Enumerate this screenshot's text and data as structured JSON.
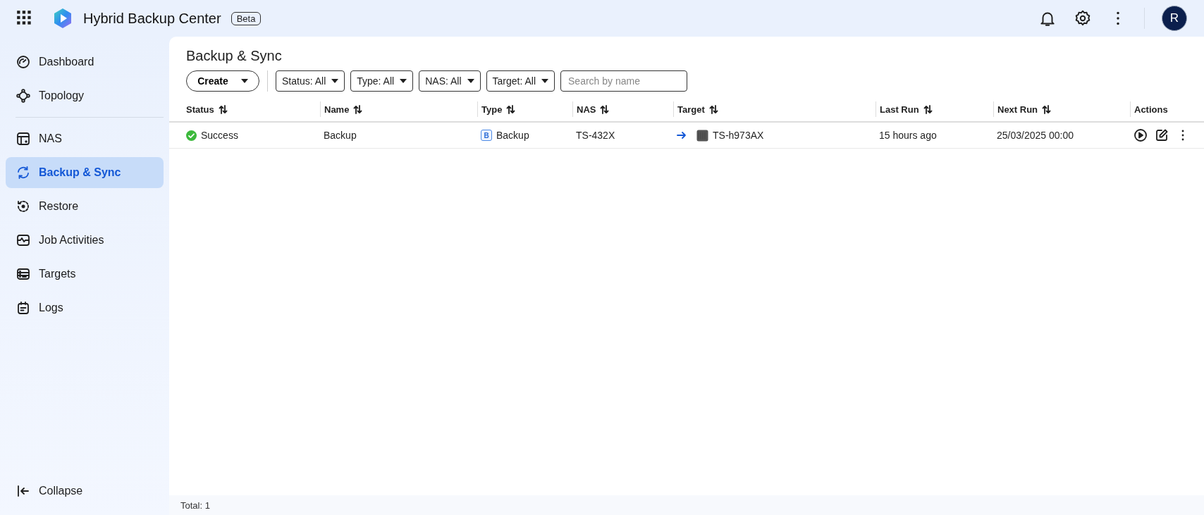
{
  "app": {
    "title": "Hybrid Backup Center",
    "badge": "Beta",
    "avatar_letter": "R"
  },
  "sidebar": {
    "sections": [
      [
        {
          "label": "Dashboard",
          "selected": false
        },
        {
          "label": "Topology",
          "selected": false
        }
      ],
      [
        {
          "label": "NAS",
          "selected": false
        },
        {
          "label": "Backup & Sync",
          "selected": true
        },
        {
          "label": "Restore",
          "selected": false
        },
        {
          "label": "Job Activities",
          "selected": false
        },
        {
          "label": "Targets",
          "selected": false
        },
        {
          "label": "Logs",
          "selected": false
        }
      ]
    ],
    "collapse": "Collapse"
  },
  "page": {
    "title": "Backup & Sync"
  },
  "toolbar": {
    "create": "Create",
    "filters": [
      "Status: All",
      "Type: All",
      "NAS: All",
      "Target: All"
    ],
    "search": {
      "placeholder": "Search by name"
    }
  },
  "table": {
    "columns": [
      "Status",
      "Name",
      "Type",
      "NAS",
      "Target",
      "Last Run",
      "Next Run",
      "Actions"
    ],
    "rows": [
      {
        "status": "Success",
        "succeeded": true,
        "name": "Backup",
        "type_badge": "B",
        "type": "Backup",
        "nas": "TS-432X",
        "target": "TS-h973AX",
        "last_run": "15 hours ago",
        "next_run": "25/03/2025 00:00"
      }
    ]
  },
  "footer": {
    "total": "Total: 1"
  }
}
